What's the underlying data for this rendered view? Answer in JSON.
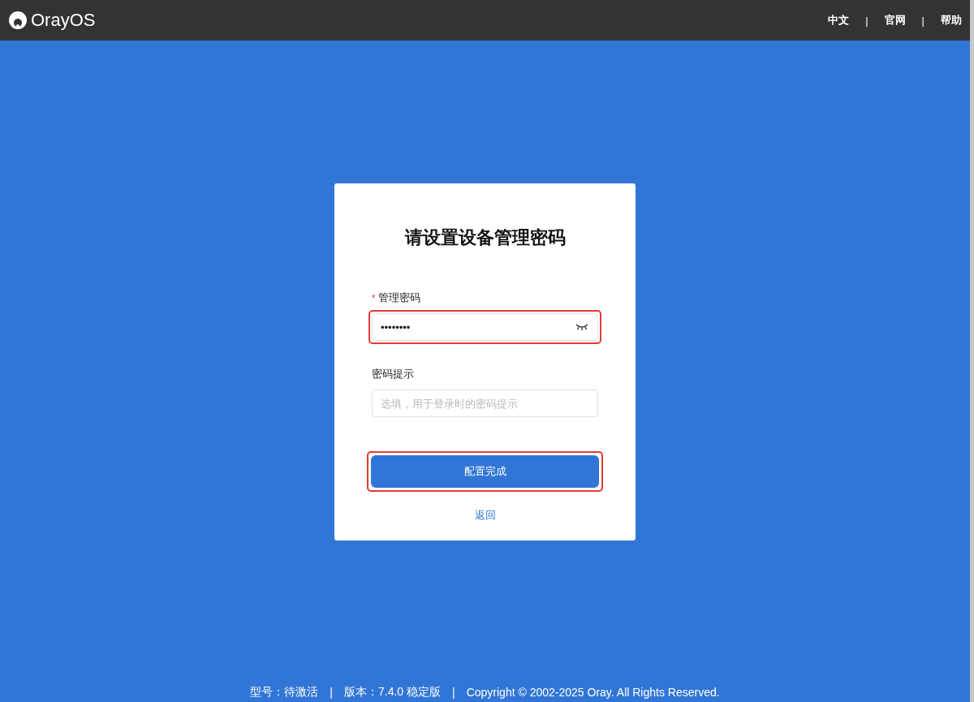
{
  "header": {
    "logo": "OrayOS",
    "links": [
      {
        "label": "中文"
      },
      {
        "label": "官网"
      },
      {
        "label": "帮助"
      }
    ],
    "separator": "|"
  },
  "card": {
    "title": "请设置设备管理密码",
    "fields": [
      {
        "kind": "password",
        "label": "管理密码",
        "required": true,
        "required_mark": "*",
        "value": "••••••••",
        "highlighted": true
      },
      {
        "kind": "text",
        "label": "密码提示",
        "required": false,
        "placeholder": "选填，用于登录时的密码提示",
        "highlighted": false
      }
    ],
    "submit": {
      "label": "配置完成",
      "highlighted": true
    },
    "back_link": "返回"
  },
  "footer": {
    "items": [
      "型号：待激活",
      "版本：7.4.0 稳定版",
      "Copyright © 2002-2025 Oray. All Rights Reserved."
    ],
    "separator": "|"
  }
}
